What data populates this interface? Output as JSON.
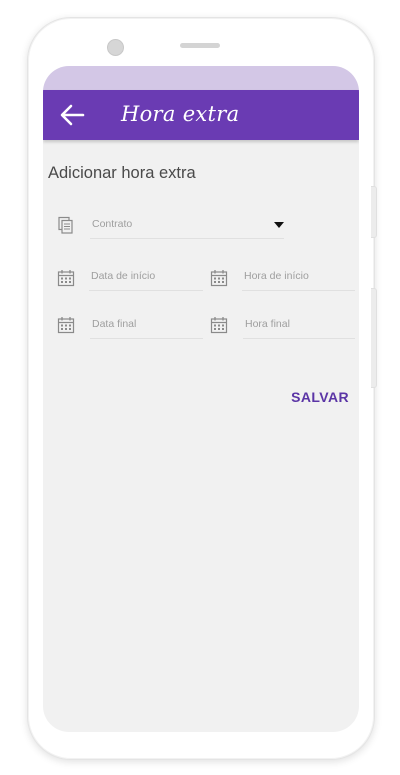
{
  "app_bar": {
    "title": "Hora extra",
    "back_icon": "arrow-left-icon"
  },
  "page": {
    "heading": "Adicionar hora extra"
  },
  "form": {
    "contract": {
      "label": "Contrato",
      "icon": "copy-document-icon"
    },
    "start_date": {
      "label": "Data de início",
      "icon": "calendar-icon"
    },
    "start_time": {
      "label": "Hora de início",
      "icon": "calendar-icon"
    },
    "end_date": {
      "label": "Data final",
      "icon": "calendar-icon"
    },
    "end_time": {
      "label": "Hora final",
      "icon": "calendar-icon"
    }
  },
  "actions": {
    "save_label": "SALVAR"
  },
  "colors": {
    "primary": "#6a3bb3",
    "status_bar": "#d3c7e6",
    "accent_text": "#5b35a6",
    "screen_background": "#f1f1f1"
  }
}
